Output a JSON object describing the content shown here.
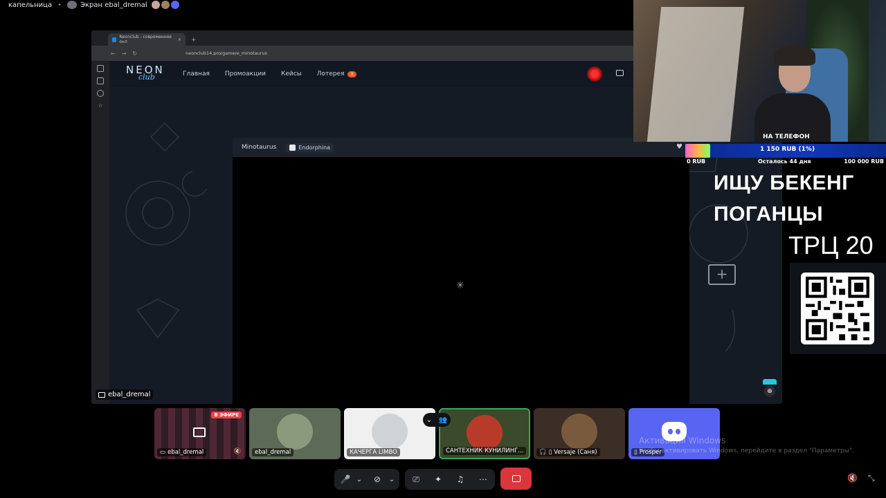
{
  "topbar": {
    "channel": "капельница",
    "screen_label": "Экран ebal_dremal"
  },
  "browser": {
    "tab_title": "Neonclub - современное онл",
    "new_tab_symbol": "+",
    "url": "neonclub14.pro/game/e_minotaurus",
    "nav_symbols": [
      "←",
      "→",
      "↻"
    ]
  },
  "site": {
    "logo_top": "NEON",
    "logo_bottom": "club",
    "menu": [
      "Главная",
      "Промоакции",
      "Кейсы",
      "Лотерея"
    ],
    "lottery_badge": "3",
    "game_title": "Minotaurus",
    "provider": "Endorphina",
    "heart_symbol": "♥",
    "spinner_symbol": "✳"
  },
  "stream": {
    "streamer_label": "ebal_dremal",
    "zoom_symbol": "⊕",
    "monitor_plus": "+"
  },
  "overlay": {
    "phone_text": "НА ТЕЛЕФОН",
    "goal_current": "1 150 RUB (1%)",
    "goal_progress": 0.0115,
    "goal_min": "0 RUB",
    "goal_remaining": "Осталось 44 дня",
    "goal_max": "100 000 RUB",
    "line1": "ИЩУ БЕКЕНГ",
    "line2": "ПОГАНЦЫ",
    "line3": "ТРЦ 20"
  },
  "participants": [
    {
      "name": "ebal_dremal",
      "badge": "В ЭФИРЕ",
      "type": "stream",
      "muted": true
    },
    {
      "name": "ebal_dremal",
      "type": "avatar",
      "color": "#8a9a7a"
    },
    {
      "name": "КАЧЕРГА LIMBO",
      "type": "avatar",
      "color": "#cfd3d6"
    },
    {
      "name": "САНТЕХНИК КУНИЛИНГ...",
      "type": "avatar",
      "color": "#b83b2a",
      "speaking": true
    },
    {
      "name": "Versaje (Саня)",
      "type": "avatar",
      "color": "#7a5a3c"
    },
    {
      "name": "Prosper",
      "type": "discord",
      "color": "#5865f2"
    }
  ],
  "windows_watermark": {
    "title": "Активация Windows",
    "subtitle": "Чтобы активировать Windows, перейдите в раздел \"Параметры\"."
  },
  "controls": {
    "mic_icon": "🎤",
    "chevron": "⌄",
    "camera_icon": "⊘",
    "share_icon": "⎚",
    "activities_icon": "✦",
    "soundboard_icon": "♫",
    "more_icon": "⋯",
    "volume_icon": "🔇",
    "fullscreen_icon": "⤡"
  },
  "colors": {
    "accent": "#5865f2",
    "live": "#ed4245",
    "speaking": "#3ba55d",
    "hangup": "#da373c"
  }
}
